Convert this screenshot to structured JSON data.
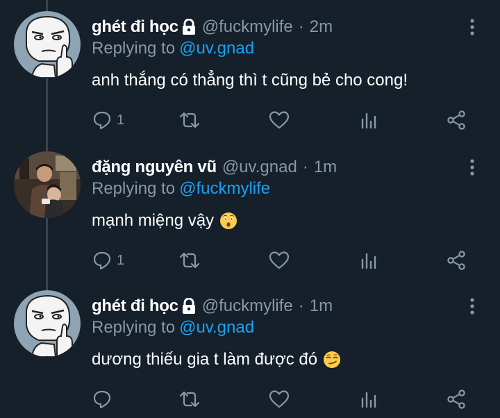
{
  "tweets": [
    {
      "display_name": "ghét đi học",
      "protected": true,
      "handle": "@fuckmylife",
      "separator": "·",
      "time": "2m",
      "replying_prefix": "Replying to",
      "replying_to": "@uv.gnad",
      "text": "anh thắng có thẳng thì t cũng bẻ cho cong!",
      "emoji": "",
      "reply_count": "1",
      "avatar": "meme-face-avatar"
    },
    {
      "display_name": "đặng nguyên vũ",
      "protected": false,
      "handle": "@uv.gnad",
      "separator": "·",
      "time": "1m",
      "replying_prefix": "Replying to",
      "replying_to": "@fuckmylife",
      "text": "mạnh miệng vậy",
      "emoji": "astonished-face",
      "reply_count": "1",
      "avatar": "photo-avatar"
    },
    {
      "display_name": "ghét đi học",
      "protected": true,
      "handle": "@fuckmylife",
      "separator": "·",
      "time": "1m",
      "replying_prefix": "Replying to",
      "replying_to": "@uv.gnad",
      "text": "dương thiếu gia t làm được đó",
      "emoji": "smirking-face",
      "reply_count": "",
      "avatar": "meme-face-avatar"
    }
  ],
  "colors": {
    "background": "#15202b",
    "text": "#ffffff",
    "secondary": "#8899a6",
    "mention": "#1da1f2",
    "thread_line": "#38444d"
  }
}
